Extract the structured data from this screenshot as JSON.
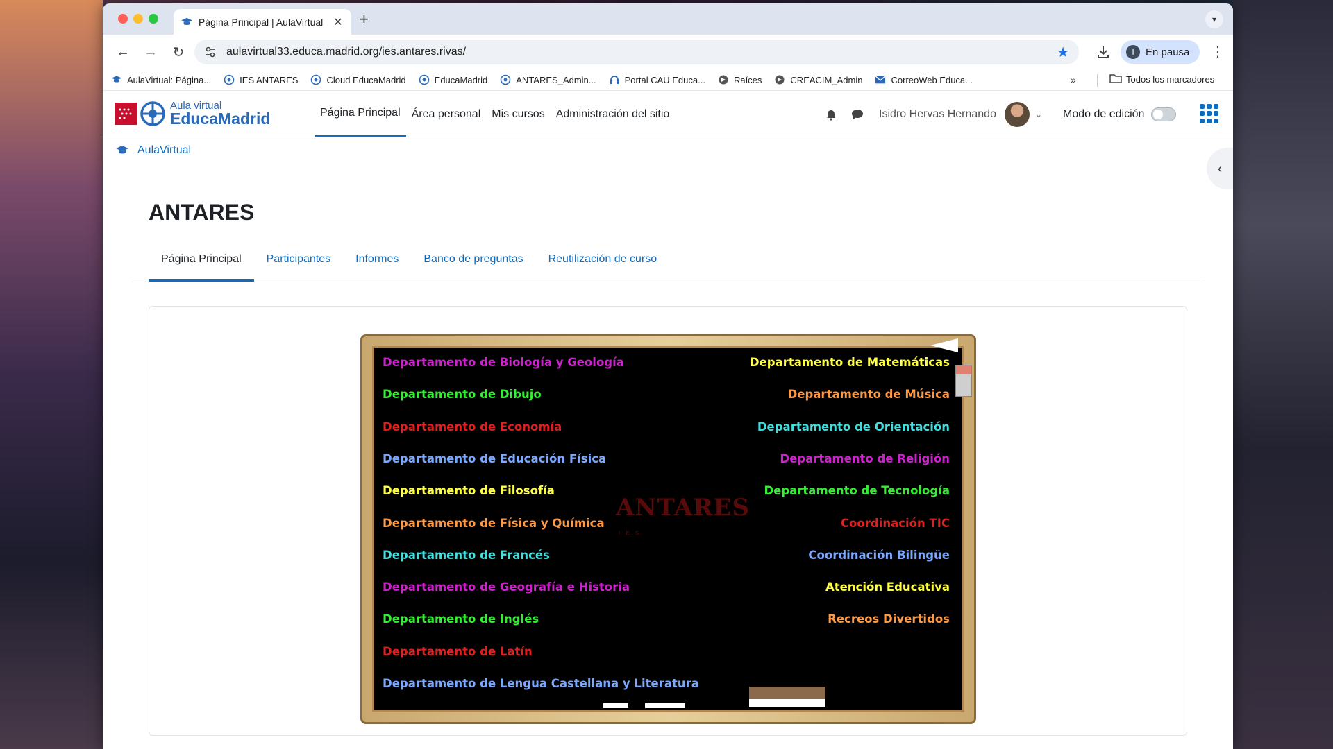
{
  "browser": {
    "tab_title": "Página Principal | AulaVirtual",
    "new_tab": "+",
    "url": "aulavirtual33.educa.madrid.org/ies.antares.rivas/",
    "profile_status": "En pausa",
    "profile_initial": "I",
    "bookmarks": [
      {
        "label": "AulaVirtual: Página..."
      },
      {
        "label": "IES ANTARES"
      },
      {
        "label": "Cloud EducaMadrid"
      },
      {
        "label": "EducaMadrid"
      },
      {
        "label": "ANTARES_Admin..."
      },
      {
        "label": "Portal CAU Educa..."
      },
      {
        "label": "Raíces"
      },
      {
        "label": "CREACIM_Admin"
      },
      {
        "label": "CorreoWeb Educa..."
      }
    ],
    "bookmarks_overflow": "»",
    "all_bookmarks": "Todos los marcadores"
  },
  "header": {
    "logo_small": "Aula virtual",
    "logo_big": "EducaMadrid",
    "nav": [
      "Página Principal",
      "Área personal",
      "Mis cursos",
      "Administración del sitio"
    ],
    "user_name": "Isidro Hervas Hernando",
    "edit_mode_label": "Modo de edición"
  },
  "breadcrumb": "AulaVirtual",
  "page_title": "ANTARES",
  "secondary_nav": [
    "Página Principal",
    "Participantes",
    "Informes",
    "Banco de preguntas",
    "Reutilización de curso"
  ],
  "board": {
    "logo_text": "ANTARES",
    "logo_sub": "I.E.S.",
    "left": [
      {
        "label": "Departamento de Biología y Geología",
        "color": "#cc22cc"
      },
      {
        "label": "Departamento de Dibujo",
        "color": "#33ee33"
      },
      {
        "label": "Departamento de Economía",
        "color": "#dd2020"
      },
      {
        "label": "Departamento de Educación Física",
        "color": "#7aa8ff"
      },
      {
        "label": "Departamento de Filosofía",
        "color": "#ffff44"
      },
      {
        "label": "Departamento de Física y Química",
        "color": "#ff9944"
      },
      {
        "label": "Departamento de Francés",
        "color": "#44dddd"
      },
      {
        "label": "Departamento de Geografía e Historia",
        "color": "#cc22cc"
      },
      {
        "label": "Departamento de Inglés",
        "color": "#33ee33"
      },
      {
        "label": "Departamento de Latín",
        "color": "#dd2020"
      },
      {
        "label": "Departamento de Lengua Castellana y Literatura",
        "color": "#7aa8ff"
      }
    ],
    "right": [
      {
        "label": "Departamento de Matemáticas",
        "color": "#ffff44"
      },
      {
        "label": "Departamento de Música",
        "color": "#ff9944"
      },
      {
        "label": "Departamento de Orientación",
        "color": "#44dddd"
      },
      {
        "label": "Departamento de Religión",
        "color": "#cc22cc"
      },
      {
        "label": "Departamento de Tecnología",
        "color": "#33ee33"
      },
      {
        "label": "Coordinación TIC",
        "color": "#dd2020"
      },
      {
        "label": "Coordinación Bilingüe",
        "color": "#7aa8ff"
      },
      {
        "label": "Atención Educativa",
        "color": "#ffff44"
      },
      {
        "label": "Recreos Divertidos",
        "color": "#ff9944"
      }
    ]
  },
  "colors": {
    "accent": "#0f6cbf",
    "brand": "#2a6ab8",
    "madrid_red": "#c8102e"
  }
}
